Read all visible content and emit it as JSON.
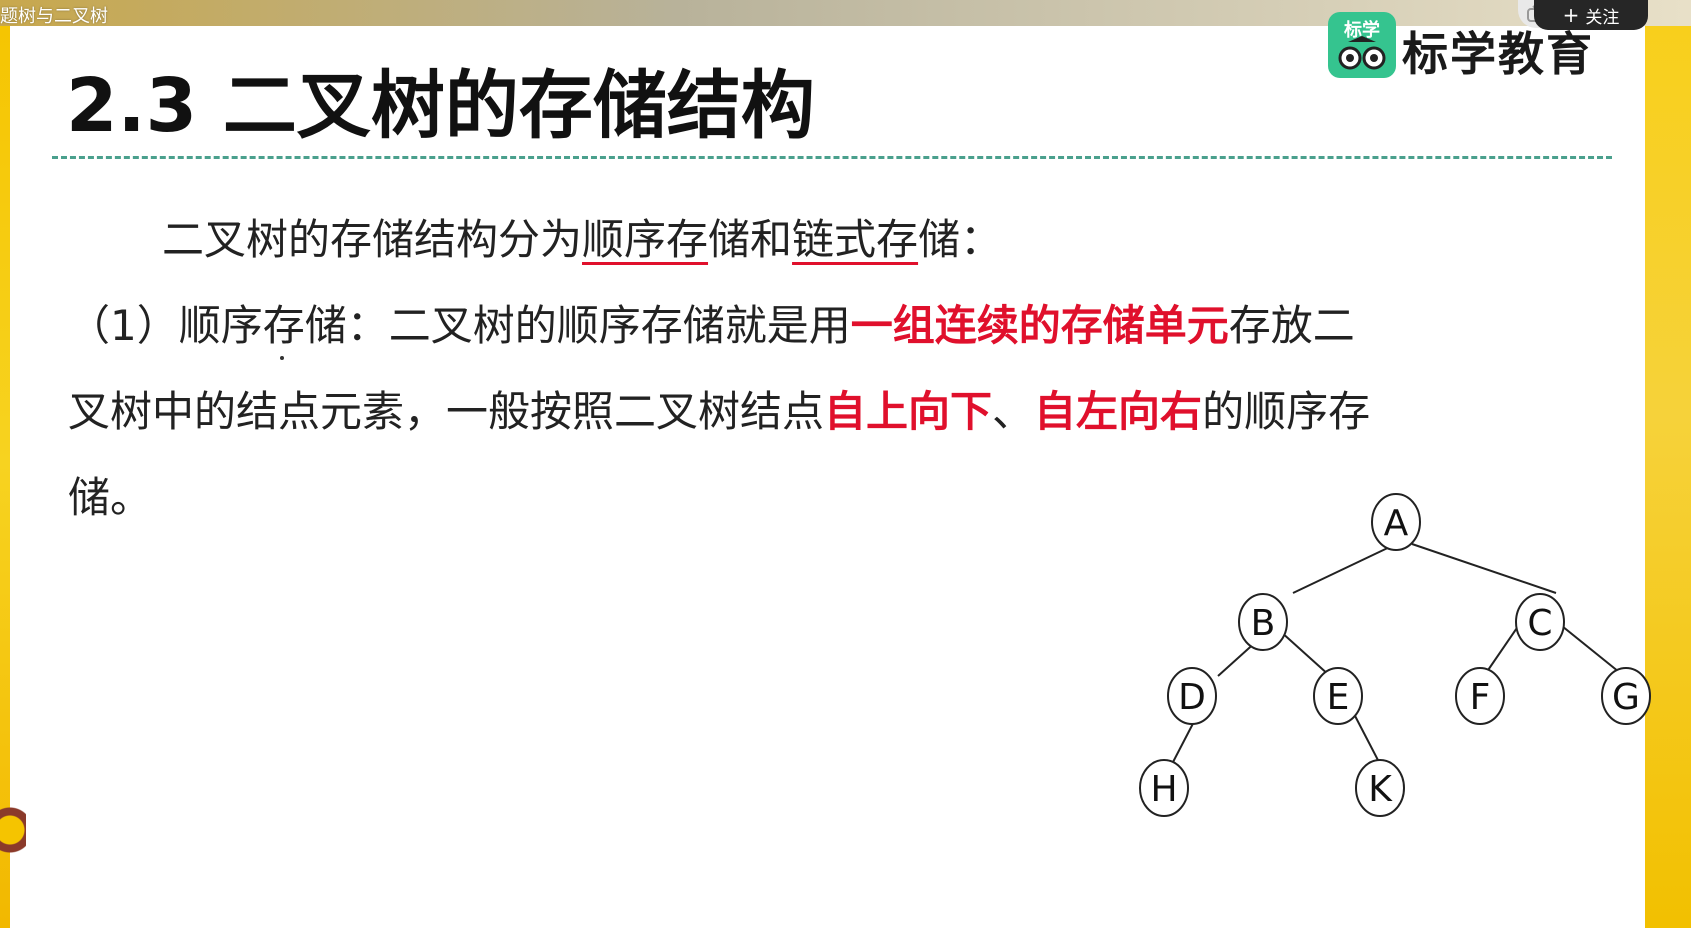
{
  "header": {
    "tab_title": "题树与二叉树",
    "follow_label": "关注",
    "tv_icon": "tv-icon",
    "plus_icon": "plus-icon"
  },
  "logo": {
    "badge_text": "标学",
    "brand_name": "标学教育"
  },
  "slide": {
    "title": "2.3  二叉树的存储结构",
    "intro": {
      "p1": "二叉树的存储结构分为",
      "u1": "顺序存",
      "p2": "储和",
      "u2": "链式存",
      "p3": "储："
    },
    "line2": {
      "p1": "（1）顺序存储：二叉树的顺序存储就是用",
      "red1": "一组连续的存储单元",
      "p2": "存放二"
    },
    "line3": {
      "p1": "叉树中的结点元素，一般按照二叉树结点",
      "red1": "自上向下",
      "p2": "、",
      "red2": "自左向右",
      "p3": "的顺序存"
    },
    "line4": "储。"
  },
  "tree": {
    "nodes": [
      "A",
      "B",
      "C",
      "D",
      "E",
      "F",
      "G",
      "H",
      "K"
    ]
  },
  "colors": {
    "accent_red": "#e0102c",
    "dash_green": "#4aa08d",
    "frame_yellow": "#f5c400",
    "logo_green": "#35c48f"
  }
}
